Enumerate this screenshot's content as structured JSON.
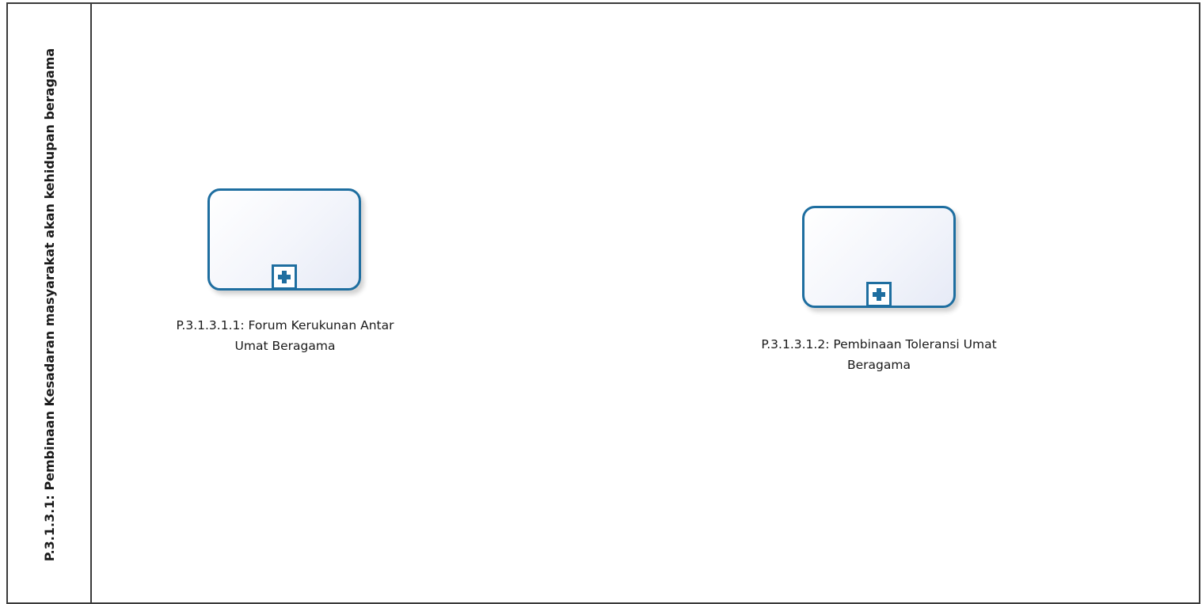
{
  "pool": {
    "title": "P.3.1.3.1: Pembinaan Kesadaran masyarakat akan kehidupan beragama"
  },
  "tasks": [
    {
      "label": "P.3.1.3.1.1: Forum Kerukunan Antar Umat Beragama",
      "marker_icon": "plus-icon"
    },
    {
      "label": "P.3.1.3.1.2: Pembinaan Toleransi Umat Beragama",
      "marker_icon": "plus-icon"
    }
  ],
  "colors": {
    "task_border": "#1e6ea0",
    "pool_border": "#3a3a3a",
    "task_fill": "#f3f5fb"
  }
}
